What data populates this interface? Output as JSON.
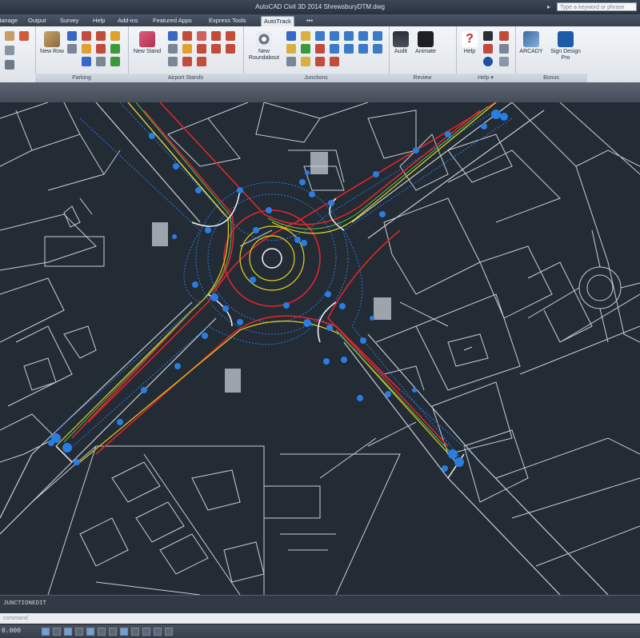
{
  "window": {
    "title": "AutoCAD Civil 3D 2014   ShrewsburyDTM.dwg",
    "help_placeholder": "Type a keyword or phrase"
  },
  "tabs": [
    "Manage",
    "Output",
    "Survey",
    "Help",
    "Add-ins",
    "Featured Apps",
    "Express Tools",
    "AutoTrack"
  ],
  "active_tab": "AutoTrack",
  "ribbon": {
    "panels": [
      {
        "title": "",
        "buttons": []
      },
      {
        "title": "Parking",
        "buttons": [
          "New Row"
        ]
      },
      {
        "title": "Airport Stands",
        "buttons": [
          "New Stand"
        ]
      },
      {
        "title": "Junctions",
        "buttons": [
          "New Roundabout"
        ]
      },
      {
        "title": "Review",
        "buttons": [
          "Audit",
          "Animate"
        ]
      },
      {
        "title": "Help",
        "buttons": [
          "Help"
        ]
      },
      {
        "title": "Bonus",
        "buttons": [
          "ARCADY",
          "Sign Design Pro"
        ]
      }
    ],
    "help_dropdown": "▾"
  },
  "command": {
    "last": "JUNCTIONEDIT",
    "placeholder": "command"
  },
  "status": {
    "coords": "0.000"
  },
  "colors": {
    "background": "#232b35",
    "linework": "#c7ced6",
    "grip": "#2a7de1",
    "red_path": "#e0262b",
    "yellow_path": "#e6d21f",
    "green_path": "#58c245"
  }
}
